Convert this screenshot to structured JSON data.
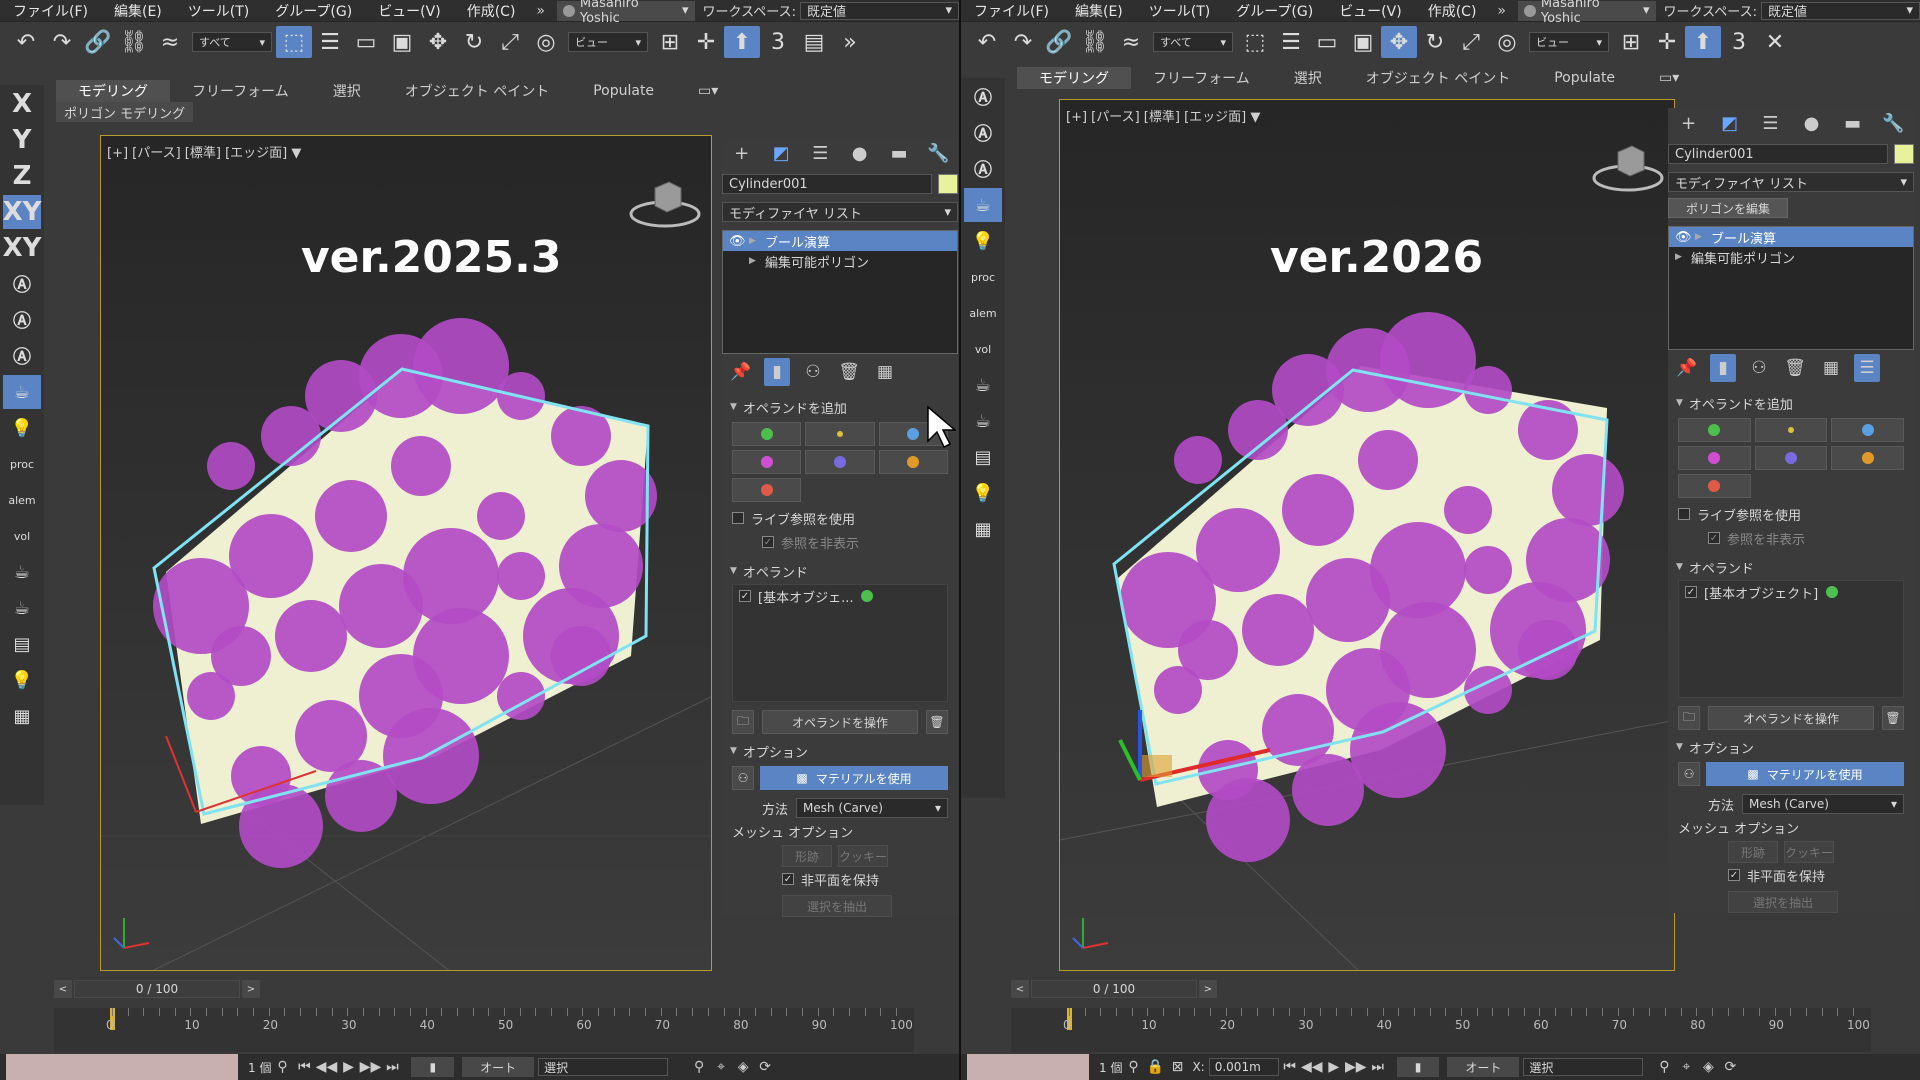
{
  "menu": [
    "ファイル(F)",
    "編集(E)",
    "ツール(T)",
    "グループ(G)",
    "ビュー(V)",
    "作成(C)"
  ],
  "user_name": "Masahiro Yoshic",
  "workspace_label": "ワークスペース:",
  "workspace_value": "既定値",
  "selection_filter": "すべて",
  "view_select": "ビュー",
  "ribbon_tabs": [
    "モデリング",
    "フリーフォーム",
    "選択",
    "オブジェクト ペイント",
    "Populate"
  ],
  "subribbon": "ポリゴン モデリング",
  "left_axes": [
    "X",
    "Y",
    "Z",
    "XY",
    "XY"
  ],
  "left_small": [
    "proc",
    "alem",
    "vol"
  ],
  "viewport_label": "[+] [パース] [標準] [エッジ面]",
  "panes": [
    {
      "version": "ver.2025.3",
      "operand_item": "[基本オブジェ..."
    },
    {
      "version": "ver.2026",
      "operand_item": "[基本オブジェクト]"
    }
  ],
  "cmd": {
    "object_name": "Cylinder001",
    "modifier_list": "モディファイヤ リスト",
    "edit_poly": "ポリゴンを編集",
    "stack": [
      "ブール演算",
      "編集可能ポリゴン"
    ],
    "add_operand": "オペランドを追加",
    "live_ref": "ライブ参照を使用",
    "hide_ref": "参照を非表示",
    "operands": "オペランド",
    "operate": "オペランドを操作",
    "options": "オプション",
    "use_material": "マテリアルを使用",
    "method_label": "方法",
    "method_value": "Mesh (Carve)",
    "mesh_options": "メッシュ オプション",
    "imprint": "形跡",
    "cookie": "クッキー",
    "keep_nonplanar": "非平面を保持",
    "extract": "選択を抽出"
  },
  "timeline": {
    "frame": "0 / 100",
    "ticks": [
      "0",
      "10",
      "20",
      "30",
      "40",
      "50",
      "60",
      "70",
      "80",
      "90",
      "100"
    ]
  },
  "status": {
    "count": "1 個",
    "auto": "オート",
    "select": "選択",
    "x_label": "X:",
    "x_value": "0.001m"
  },
  "colors": {
    "accent": "#5a84c4",
    "sphere": "#b24bc4",
    "viewport_border": "#b79a2c",
    "selection": "#7fe3f2"
  }
}
